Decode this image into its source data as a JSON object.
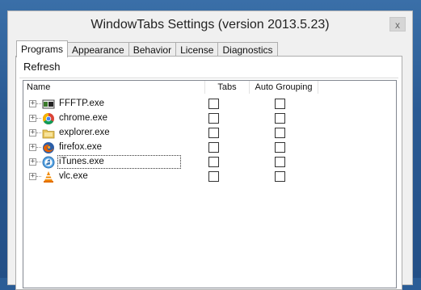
{
  "window": {
    "title": "WindowTabs Settings (version 2013.5.23)",
    "close_label": "x"
  },
  "tabs": [
    {
      "label": "Programs",
      "active": true
    },
    {
      "label": "Appearance",
      "active": false
    },
    {
      "label": "Behavior",
      "active": false
    },
    {
      "label": "License",
      "active": false
    },
    {
      "label": "Diagnostics",
      "active": false
    }
  ],
  "toolbar": {
    "refresh_label": "Refresh"
  },
  "list": {
    "columns": [
      "Name",
      "Tabs",
      "Auto Grouping"
    ],
    "expander_symbol": "+",
    "rows": [
      {
        "name": "FFFTP.exe",
        "icon": "ffftp-icon",
        "tabs": false,
        "auto_grouping": false
      },
      {
        "name": "chrome.exe",
        "icon": "chrome-icon",
        "tabs": false,
        "auto_grouping": false
      },
      {
        "name": "explorer.exe",
        "icon": "folder-icon",
        "tabs": false,
        "auto_grouping": false
      },
      {
        "name": "firefox.exe",
        "icon": "firefox-icon",
        "tabs": false,
        "auto_grouping": false
      },
      {
        "name": "iTunes.exe",
        "icon": "itunes-icon",
        "tabs": false,
        "auto_grouping": false,
        "focused": true
      },
      {
        "name": "vlc.exe",
        "icon": "vlc-icon",
        "tabs": false,
        "auto_grouping": false
      }
    ]
  }
}
